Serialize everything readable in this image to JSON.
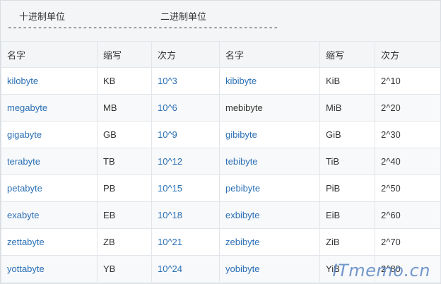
{
  "header": {
    "decimal_title": "十进制单位",
    "binary_title": "二进制单位",
    "divider": "------------------------------------------------------"
  },
  "columns": [
    "名字",
    "缩写",
    "次方",
    "名字",
    "缩写",
    "次方"
  ],
  "rows": [
    {
      "dec_name": "kilobyte",
      "dec_abbr": "KB",
      "dec_pow": "10^3",
      "bin_name": "kibibyte",
      "bin_abbr": "KiB",
      "bin_pow": "2^10"
    },
    {
      "dec_name": "megabyte",
      "dec_abbr": "MB",
      "dec_pow": "10^6",
      "bin_name": "mebibyte",
      "bin_abbr": "MiB",
      "bin_pow": "2^20"
    },
    {
      "dec_name": "gigabyte",
      "dec_abbr": "GB",
      "dec_pow": "10^9",
      "bin_name": "gibibyte",
      "bin_abbr": "GiB",
      "bin_pow": "2^30"
    },
    {
      "dec_name": "terabyte",
      "dec_abbr": "TB",
      "dec_pow": "10^12",
      "bin_name": "tebibyte",
      "bin_abbr": "TiB",
      "bin_pow": "2^40"
    },
    {
      "dec_name": "petabyte",
      "dec_abbr": "PB",
      "dec_pow": "10^15",
      "bin_name": "pebibyte",
      "bin_abbr": "PiB",
      "bin_pow": "2^50"
    },
    {
      "dec_name": "exabyte",
      "dec_abbr": "EB",
      "dec_pow": "10^18",
      "bin_name": "exbibyte",
      "bin_abbr": "EiB",
      "bin_pow": "2^60"
    },
    {
      "dec_name": "zettabyte",
      "dec_abbr": "ZB",
      "dec_pow": "10^21",
      "bin_name": "zebibyte",
      "bin_abbr": "ZiB",
      "bin_pow": "2^70"
    },
    {
      "dec_name": "yottabyte",
      "dec_abbr": "YB",
      "dec_pow": "10^24",
      "bin_name": "yobibyte",
      "bin_abbr": "YiB",
      "bin_pow": "2^80"
    }
  ],
  "watermark": "ITmemo.cn",
  "colors": {
    "link": "#2a6fb5",
    "header_bg": "#f3f5f7",
    "border": "#e2e5e9",
    "watermark": "#5a87c4"
  }
}
